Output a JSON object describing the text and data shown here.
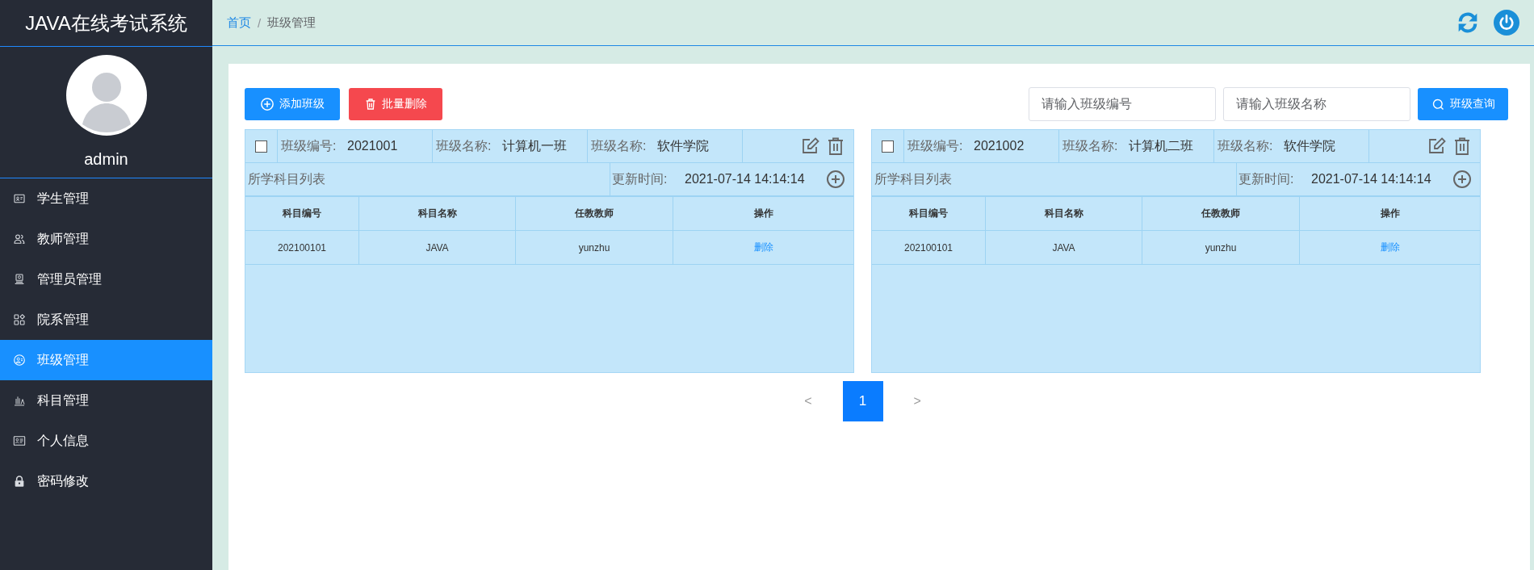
{
  "sidebar": {
    "title": "JAVA在线考试系统",
    "username": "admin",
    "items": [
      {
        "label": "学生管理",
        "kind": "id-card",
        "selected": false
      },
      {
        "label": "教师管理",
        "kind": "users",
        "selected": false
      },
      {
        "label": "管理员管理",
        "kind": "admin",
        "selected": false
      },
      {
        "label": "院系管理",
        "kind": "grid",
        "selected": false
      },
      {
        "label": "班级管理",
        "kind": "class",
        "selected": true
      },
      {
        "label": "科目管理",
        "kind": "books",
        "selected": false
      },
      {
        "label": "个人信息",
        "kind": "card",
        "selected": false
      },
      {
        "label": "密码修改",
        "kind": "lock",
        "selected": false
      }
    ]
  },
  "breadcrumb": {
    "separator": "/",
    "items": [
      {
        "label": "首页",
        "link": true
      },
      {
        "label": "班级管理",
        "link": false
      }
    ]
  },
  "toolbar": {
    "buttons": [
      {
        "label": "添加班级",
        "kind": "add"
      },
      {
        "label": "批量删除",
        "kind": "delete"
      }
    ],
    "search_fields": [
      {
        "placeholder": "请输入班级编号"
      },
      {
        "placeholder": "请输入班级名称"
      }
    ],
    "search_button": "班级查询"
  },
  "classes": [
    {
      "checked": false,
      "fields": [
        {
          "label": "班级编号:",
          "value": "2021001"
        },
        {
          "label": "班级名称:",
          "value": "计算机一班"
        },
        {
          "label": "班级名称:",
          "value": "软件学院"
        }
      ],
      "subjects_title": "所学科目列表",
      "updated_label": "更新时间:",
      "updated_value": "2021-07-14 14:14:14",
      "columns": [
        "科目编号",
        "科目名称",
        "任教教师",
        "操作"
      ],
      "rows": [
        {
          "cells": [
            "202100101",
            "JAVA",
            "yunzhu"
          ],
          "action": "删除"
        }
      ]
    },
    {
      "checked": false,
      "fields": [
        {
          "label": "班级编号:",
          "value": "2021002"
        },
        {
          "label": "班级名称:",
          "value": "计算机二班"
        },
        {
          "label": "班级名称:",
          "value": "软件学院"
        }
      ],
      "subjects_title": "所学科目列表",
      "updated_label": "更新时间:",
      "updated_value": "2021-07-14 14:14:14",
      "columns": [
        "科目编号",
        "科目名称",
        "任教教师",
        "操作"
      ],
      "rows": [
        {
          "cells": [
            "202100101",
            "JAVA",
            "yunzhu"
          ],
          "action": "删除"
        }
      ]
    }
  ],
  "pagination": {
    "prev": "<",
    "next": ">",
    "pages": [
      {
        "label": "1",
        "selected": true
      }
    ]
  }
}
